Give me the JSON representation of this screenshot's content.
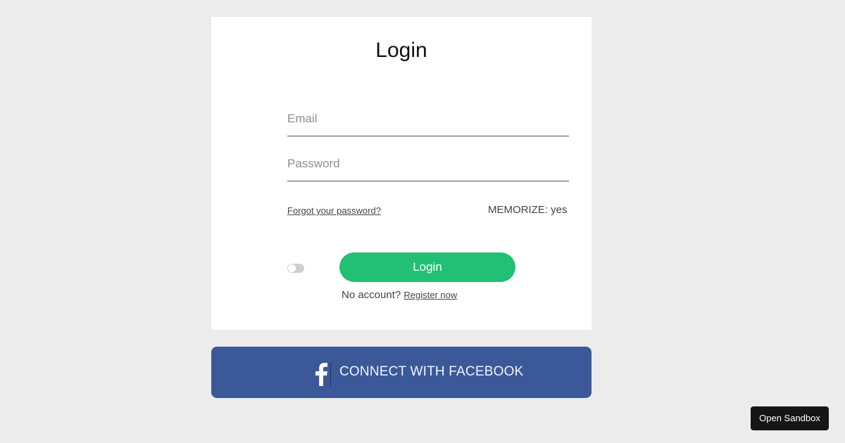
{
  "login_card": {
    "title": "Login",
    "email_placeholder": "Email",
    "password_placeholder": "Password",
    "forgot_password": "Forgot your password?",
    "memorize_text": "MEMORIZE: yes",
    "remember_toggle_on": false,
    "login_button": "Login",
    "no_account_text": "No account?",
    "register_link": "Register now"
  },
  "facebook": {
    "label": "CONNECT WITH FACEBOOK",
    "icon": "facebook-f-icon",
    "color": "#3b5998"
  },
  "sandbox": {
    "label": "Open Sandbox"
  },
  "colors": {
    "background": "#ececec",
    "card": "#ffffff",
    "login_button": "#21c074",
    "sandbox_button": "#151515"
  }
}
